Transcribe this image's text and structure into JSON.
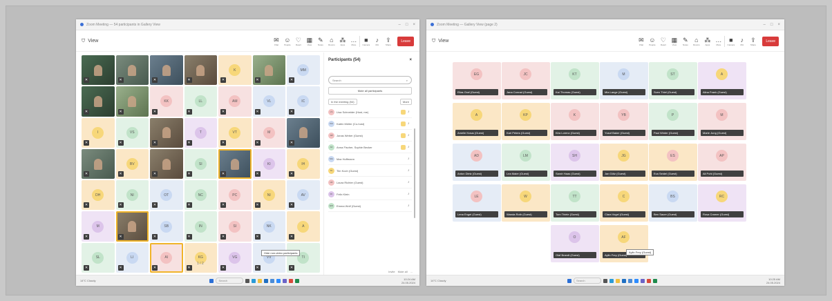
{
  "left_window": {
    "title": "Zoom Meeting — 54 participants in Gallery View",
    "meeting_label": "View",
    "toolbar_tools": [
      {
        "icon": "chat-icon",
        "label": "Chat"
      },
      {
        "icon": "people-icon",
        "label": "People"
      },
      {
        "icon": "reactions-icon",
        "label": "React"
      },
      {
        "icon": "view-icon",
        "label": "View"
      },
      {
        "icon": "notes-icon",
        "label": "Notes"
      },
      {
        "icon": "rooms-icon",
        "label": "Rooms"
      },
      {
        "icon": "apps-icon",
        "label": "Apps"
      },
      {
        "icon": "more-icon",
        "label": "More"
      }
    ],
    "toolbar_right": [
      {
        "icon": "camera-icon",
        "label": "Camera"
      },
      {
        "icon": "mic-icon",
        "label": "Mic"
      },
      {
        "icon": "share-icon",
        "label": "Share"
      }
    ],
    "leave_label": "Leave",
    "gallery": [
      {
        "initials": "",
        "video": true,
        "variant": "v1"
      },
      {
        "initials": "",
        "video": true,
        "variant": "v2"
      },
      {
        "initials": "",
        "video": true,
        "variant": "v3"
      },
      {
        "initials": "",
        "video": true,
        "variant": "v4"
      },
      {
        "initials": "K",
        "video": false,
        "color": "#fbe7c6",
        "ring": "#f7d77a"
      },
      {
        "initials": "",
        "video": true,
        "variant": "v5"
      },
      {
        "initials": "MM",
        "video": false,
        "color": "#e5ecf6",
        "ring": "#c9d9f2"
      },
      {
        "initials": "",
        "video": true,
        "variant": "v1"
      },
      {
        "initials": "",
        "video": true,
        "variant": "v5"
      },
      {
        "initials": "KK",
        "video": false,
        "color": "#f7e1e1",
        "ring": "#f3c2c2"
      },
      {
        "initials": "LL",
        "video": false,
        "color": "#e2f2e6",
        "ring": "#c1e3c9"
      },
      {
        "initials": "AM",
        "video": false,
        "color": "#f7e1e1",
        "ring": "#f3c2c2"
      },
      {
        "initials": "VL",
        "video": false,
        "color": "#e5ecf6",
        "ring": "#c9d9f2"
      },
      {
        "initials": "IC",
        "video": false,
        "color": "#e5ecf6",
        "ring": "#c9d9f2"
      },
      {
        "initials": "I",
        "video": false,
        "color": "#fbe7c6",
        "ring": "#f7d77a"
      },
      {
        "initials": "VS",
        "video": false,
        "color": "#e2f2e6",
        "ring": "#c1e3c9"
      },
      {
        "initials": "",
        "video": true,
        "variant": "v4"
      },
      {
        "initials": "T",
        "video": false,
        "color": "#efe3f5",
        "ring": "#dcc4ea"
      },
      {
        "initials": "VT",
        "video": false,
        "color": "#fbe7c6",
        "ring": "#f7d77a"
      },
      {
        "initials": "M",
        "video": false,
        "color": "#f7e1e1",
        "ring": "#f3c2c2"
      },
      {
        "initials": "",
        "video": true,
        "variant": "v3"
      },
      {
        "initials": "",
        "video": true,
        "variant": "v2"
      },
      {
        "initials": "BV",
        "video": false,
        "color": "#fbe7c6",
        "ring": "#f7d77a"
      },
      {
        "initials": "",
        "video": true,
        "variant": "v4"
      },
      {
        "initials": "SI",
        "video": false,
        "color": "#e2f2e6",
        "ring": "#c1e3c9"
      },
      {
        "initials": "",
        "video": true,
        "variant": "v3",
        "speaking": true
      },
      {
        "initials": "KI",
        "video": false,
        "color": "#efe3f5",
        "ring": "#dcc4ea"
      },
      {
        "initials": "IH",
        "video": false,
        "color": "#fbe7c6",
        "ring": "#f7d77a"
      },
      {
        "initials": "DH",
        "video": false,
        "color": "#fbe7c6",
        "ring": "#f7d77a"
      },
      {
        "initials": "NI",
        "video": false,
        "color": "#e2f2e6",
        "ring": "#c1e3c9"
      },
      {
        "initials": "OT",
        "video": false,
        "color": "#e5ecf6",
        "ring": "#c9d9f2"
      },
      {
        "initials": "NC",
        "video": false,
        "color": "#e2f2e6",
        "ring": "#c1e3c9"
      },
      {
        "initials": "PC",
        "video": false,
        "color": "#f7e1e1",
        "ring": "#f3c2c2"
      },
      {
        "initials": "NI",
        "video": false,
        "color": "#fbe7c6",
        "ring": "#f7d77a"
      },
      {
        "initials": "AV",
        "video": false,
        "color": "#e5ecf6",
        "ring": "#c9d9f2"
      },
      {
        "initials": "M",
        "video": false,
        "color": "#efe3f5",
        "ring": "#dcc4ea"
      },
      {
        "initials": "",
        "video": true,
        "variant": "v4",
        "speaking": true
      },
      {
        "initials": "SB",
        "video": false,
        "color": "#e5ecf6",
        "ring": "#c9d9f2"
      },
      {
        "initials": "IN",
        "video": false,
        "color": "#e2f2e6",
        "ring": "#c1e3c9"
      },
      {
        "initials": "SI",
        "video": false,
        "color": "#f7e1e1",
        "ring": "#f3c2c2"
      },
      {
        "initials": "NK",
        "video": false,
        "color": "#e5ecf6",
        "ring": "#c9d9f2"
      },
      {
        "initials": "A",
        "video": false,
        "color": "#fbe7c6",
        "ring": "#f7d77a"
      },
      {
        "initials": "SL",
        "video": false,
        "color": "#e2f2e6",
        "ring": "#c1e3c9"
      },
      {
        "initials": "LI",
        "video": false,
        "color": "#e5ecf6",
        "ring": "#c9d9f2"
      },
      {
        "initials": "AI",
        "video": false,
        "color": "#f7e1e1",
        "ring": "#f3c2c2",
        "speaking": true
      },
      {
        "initials": "KG",
        "video": false,
        "color": "#fbe7c6",
        "ring": "#f7d77a"
      },
      {
        "initials": "VG",
        "video": false,
        "color": "#efe3f5",
        "ring": "#dcc4ea"
      },
      {
        "initials": "VV",
        "video": false,
        "color": "#e5ecf6",
        "ring": "#c9d9f2"
      },
      {
        "initials": "TI",
        "video": false,
        "color": "#e2f2e6",
        "ring": "#c1e3c9"
      }
    ],
    "tooltip": "Hide non-video participants",
    "pager": "1 / 2",
    "participants": {
      "title": "Participants (54)",
      "search_placeholder": "Search",
      "mute_all": "Mute all participants",
      "tab_waiting": "In the meeting (54)",
      "tab_more": "More",
      "rows": [
        {
          "initials": "LS",
          "name": "Lisa Schneider (Host, me)",
          "color": "#f3c2c2",
          "hand": true
        },
        {
          "initials": "KM",
          "name": "Katrin Müller (Co-host)",
          "color": "#c9d9f2",
          "hand": true
        },
        {
          "initials": "JW",
          "name": "Jonas Weber (Guest)",
          "color": "#f3c2c2",
          "hand": true
        },
        {
          "initials": "AF",
          "name": "Anna Fischer, Sophie Becker",
          "color": "#c1e3c9",
          "hand": true
        },
        {
          "initials": "MH",
          "name": "Max Hoffmann",
          "color": "#c9d9f2",
          "hand": false
        },
        {
          "initials": "TK",
          "name": "Tim Koch (Guest)",
          "color": "#f7d77a",
          "hand": false
        },
        {
          "initials": "LR",
          "name": "Laura Richter (Guest)",
          "color": "#f3c2c2",
          "hand": false
        },
        {
          "initials": "FK",
          "name": "Felix Klein",
          "color": "#dcc4ea",
          "hand": false
        },
        {
          "initials": "EW",
          "name": "Emma Wolf (Guest)",
          "color": "#c1e3c9",
          "hand": false
        }
      ],
      "footer": [
        "Invite",
        "Mute all",
        "..."
      ]
    },
    "taskbar": {
      "weather": "14°C Cloudy",
      "search": "Search",
      "clock": "10:24 AM",
      "date": "24.05.2024"
    }
  },
  "right_window": {
    "title": "Zoom Meeting — Gallery View (page 2)",
    "meeting_label": "View",
    "leave_label": "Leave",
    "cards": [
      {
        "initials": "EG",
        "name": "Elias Graf (Guest)",
        "color": "#f7e1e1",
        "ring": "#f3c2c2"
      },
      {
        "initials": "JC",
        "name": "Jana Conrad (Guest)",
        "color": "#f7e1e1",
        "ring": "#f3c2c2"
      },
      {
        "initials": "KT",
        "name": "Kai Thomas (Guest)",
        "color": "#e2f2e6",
        "ring": "#c1e3c9"
      },
      {
        "initials": "M",
        "name": "Mia Lange (Guest)",
        "color": "#e5ecf6",
        "ring": "#c9d9f2"
      },
      {
        "initials": "ST",
        "name": "Sven Thiel (Guest)",
        "color": "#e2f2e6",
        "ring": "#c1e3c9"
      },
      {
        "initials": "A",
        "name": "Alina Frank (Guest)",
        "color": "#efe3f5",
        "ring": "#f7d77a"
      },
      {
        "initials": "A",
        "name": "Amelie Kraus (Guest)",
        "color": "#fbe7c6",
        "ring": "#f7d77a"
      },
      {
        "initials": "KP",
        "name": "Karl Peters (Guest)",
        "color": "#fbe7c6",
        "ring": "#f7d77a"
      },
      {
        "initials": "K",
        "name": "Kira Lorenz (Guest)",
        "color": "#f7e1e1",
        "ring": "#f3c2c2"
      },
      {
        "initials": "YB",
        "name": "Yusuf Baker (Guest)",
        "color": "#f7e1e1",
        "ring": "#f3c2c2"
      },
      {
        "initials": "P",
        "name": "Paul Winter (Guest)",
        "color": "#e2f2e6",
        "ring": "#c1e3c9"
      },
      {
        "initials": "M",
        "name": "Marie Jung (Guest)",
        "color": "#f7e1e1",
        "ring": "#f3c2c2"
      },
      {
        "initials": "AD",
        "name": "Anton Dietz (Guest)",
        "color": "#e5ecf6",
        "ring": "#f3c2c2"
      },
      {
        "initials": "LM",
        "name": "Lea Maier (Guest)",
        "color": "#e2f2e6",
        "ring": "#c1e3c9"
      },
      {
        "initials": "SH",
        "name": "Sarah Haas (Guest)",
        "color": "#efe3f5",
        "ring": "#dcc4ea"
      },
      {
        "initials": "JG",
        "name": "Jan Götz (Guest)",
        "color": "#fbe7c6",
        "ring": "#f7d77a"
      },
      {
        "initials": "ES",
        "name": "Eva Seidel (Guest)",
        "color": "#fbe7c6",
        "ring": "#f3c2c2"
      },
      {
        "initials": "AP",
        "name": "Ali Pohl (Guest)",
        "color": "#f7e1e1",
        "ring": "#f3c2c2"
      },
      {
        "initials": "LE",
        "name": "Lena Engel (Guest)",
        "color": "#e5ecf6",
        "ring": "#f3c2c2"
      },
      {
        "initials": "W",
        "name": "Wanda Roth (Guest)",
        "color": "#fbe7c6",
        "ring": "#f7d77a"
      },
      {
        "initials": "TT",
        "name": "Tom Thiele (Guest)",
        "color": "#e2f2e6",
        "ring": "#c1e3c9"
      },
      {
        "initials": "C",
        "name": "Clara Vogel (Guest)",
        "color": "#fbe7c6",
        "ring": "#f7d77a"
      },
      {
        "initials": "BS",
        "name": "Ben Sauer (Guest)",
        "color": "#e5ecf6",
        "ring": "#c9d9f2"
      },
      {
        "initials": "RC",
        "name": "Rosa Cramer (Guest)",
        "color": "#efe3f5",
        "ring": "#f7d77a"
      },
      {
        "initials": "O",
        "name": "Olaf Brandt (Guest)",
        "color": "#efe3f5",
        "ring": "#dcc4ea"
      },
      {
        "initials": "AF",
        "name": "Aylin Frey (Guest)",
        "color": "#fbe7c6",
        "ring": "#f7d77a"
      }
    ],
    "tooltip": "Aylin Frey (Guest)",
    "taskbar": {
      "weather": "14°C Cloudy",
      "search": "Search",
      "clock": "10:25 AM",
      "date": "24.05.2024"
    }
  }
}
